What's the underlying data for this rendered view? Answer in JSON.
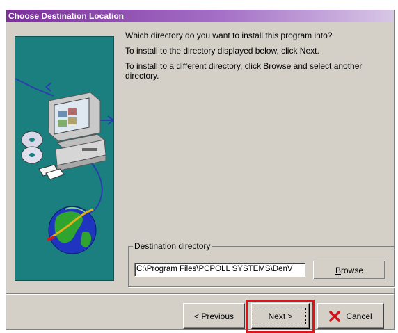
{
  "window": {
    "title": "Choose Destination Location"
  },
  "instructions": {
    "line1": "Which directory do you want to install this program into?",
    "line2": "To install to the directory displayed below, click Next.",
    "line3": "To install to a different directory, click Browse and select another directory."
  },
  "destination": {
    "group_label": "Destination directory",
    "path": "C:\\Program Files\\PCPOLL SYSTEMS\\DenV",
    "browse_first": "B",
    "browse_rest": "rowse"
  },
  "buttons": {
    "previous_label": "< Previous",
    "next_label": "Next >",
    "cancel_label": "Cancel"
  },
  "colors": {
    "title_bar": "#7b2f9a",
    "illustration_bg": "#1b7f7f",
    "highlight": "#e0121c",
    "cancel_icon": "#d0161c"
  },
  "icons": [
    "setup-illustration",
    "cancel-x-icon"
  ]
}
